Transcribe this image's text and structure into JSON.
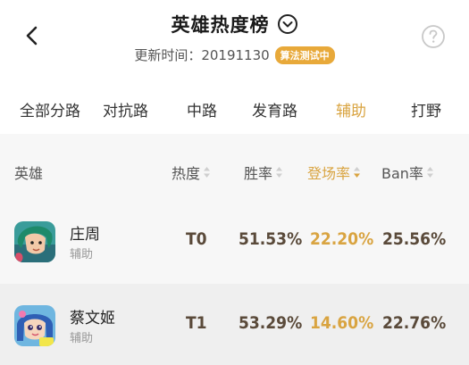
{
  "header": {
    "title": "英雄热度榜",
    "update_text": "更新时间：20191130",
    "badge": "算法测试中"
  },
  "tabs": [
    {
      "label": "全部分路",
      "active": false
    },
    {
      "label": "对抗路",
      "active": false
    },
    {
      "label": "中路",
      "active": false
    },
    {
      "label": "发育路",
      "active": false
    },
    {
      "label": "辅助",
      "active": true
    },
    {
      "label": "打野",
      "active": false
    }
  ],
  "table": {
    "headers": {
      "hero": "英雄",
      "heat": "热度",
      "win": "胜率",
      "pick": "登场率",
      "ban": "Ban率"
    },
    "sorted_by": "pick",
    "rows": [
      {
        "name": "庄周",
        "role": "辅助",
        "tier": "T0",
        "win": "51.53%",
        "pick": "22.20%",
        "ban": "25.56%"
      },
      {
        "name": "蔡文姬",
        "role": "辅助",
        "tier": "T1",
        "win": "53.29%",
        "pick": "14.60%",
        "ban": "22.76%"
      }
    ]
  },
  "colors": {
    "accent": "#d9a441",
    "badge": "#e8a93a",
    "value": "#5a4a3a"
  },
  "icons": {
    "back": "back-arrow-icon",
    "dropdown": "chevron-down-circle-icon",
    "help": "question-circle-icon",
    "sort": "sort-icon"
  }
}
